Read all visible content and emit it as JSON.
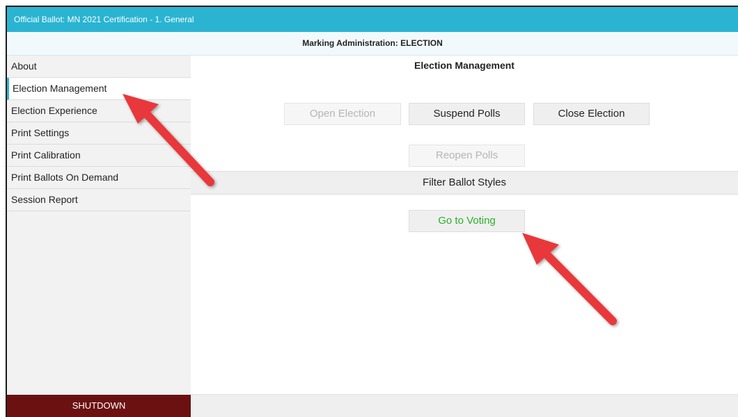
{
  "window": {
    "title": "Official Ballot: MN 2021 Certification - 1. General"
  },
  "header": {
    "subtitle": "Marking Administration: ELECTION"
  },
  "sidebar": {
    "items": [
      {
        "label": "About",
        "active": false
      },
      {
        "label": "Election Management",
        "active": true
      },
      {
        "label": "Election Experience",
        "active": false
      },
      {
        "label": "Print Settings",
        "active": false
      },
      {
        "label": "Print Calibration",
        "active": false
      },
      {
        "label": "Print Ballots On Demand",
        "active": false
      },
      {
        "label": "Session Report",
        "active": false
      }
    ],
    "shutdown_label": "SHUTDOWN"
  },
  "main": {
    "title": "Election Management",
    "buttons": {
      "open_election": "Open Election",
      "suspend_polls": "Suspend Polls",
      "close_election": "Close Election",
      "reopen_polls": "Reopen Polls",
      "go_to_voting": "Go to Voting"
    },
    "filter_label": "Filter Ballot Styles"
  },
  "colors": {
    "titlebar": "#2ab4d2",
    "shutdown": "#6b1111",
    "go_text": "#2ab02a",
    "annotation_arrow": "#e8383b"
  }
}
